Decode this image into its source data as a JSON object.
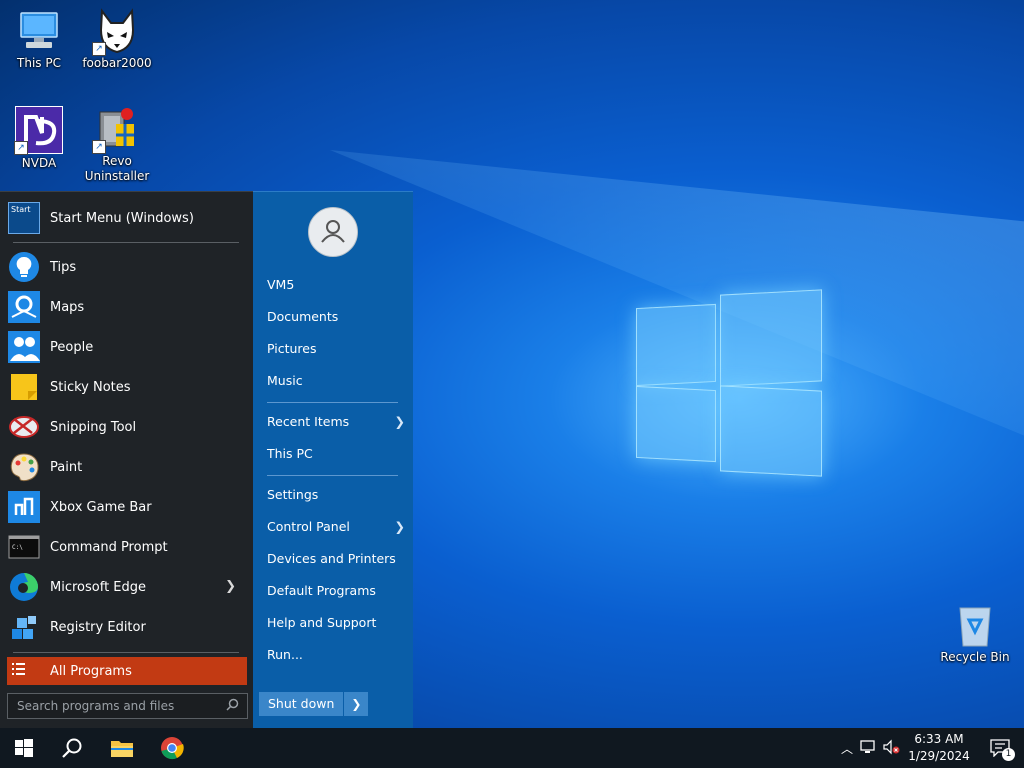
{
  "desktop": {
    "icons": [
      {
        "label": "This PC"
      },
      {
        "label": "foobar2000"
      },
      {
        "label": "NVDA"
      },
      {
        "label": "Revo\nUninstaller"
      },
      {
        "label": "Recycle Bin"
      }
    ]
  },
  "start_menu": {
    "pinned_header": {
      "label": "Start Menu (Windows)",
      "icon_text": "Start"
    },
    "items": [
      {
        "label": "Tips"
      },
      {
        "label": "Maps"
      },
      {
        "label": "People"
      },
      {
        "label": "Sticky Notes"
      },
      {
        "label": "Snipping Tool"
      },
      {
        "label": "Paint"
      },
      {
        "label": "Xbox Game Bar"
      },
      {
        "label": "Command Prompt"
      },
      {
        "label": "Microsoft Edge"
      },
      {
        "label": "Registry Editor"
      }
    ],
    "all_programs": "All Programs",
    "search_placeholder": "Search programs and files",
    "right": {
      "user": "VM5",
      "links": [
        "Documents",
        "Pictures",
        "Music"
      ],
      "recent_items": "Recent Items",
      "this_pc": "This PC",
      "settings": "Settings",
      "control_panel": "Control Panel",
      "devices_printers": "Devices and Printers",
      "default_programs": "Default Programs",
      "help_support": "Help and Support",
      "run": "Run...",
      "shutdown": "Shut down"
    },
    "accent_color": "#c23a13",
    "right_pane_color": "#0a5ea8"
  },
  "taskbar": {
    "clock_time": "6:33 AM",
    "clock_date": "1/29/2024",
    "notification_count": "1"
  }
}
